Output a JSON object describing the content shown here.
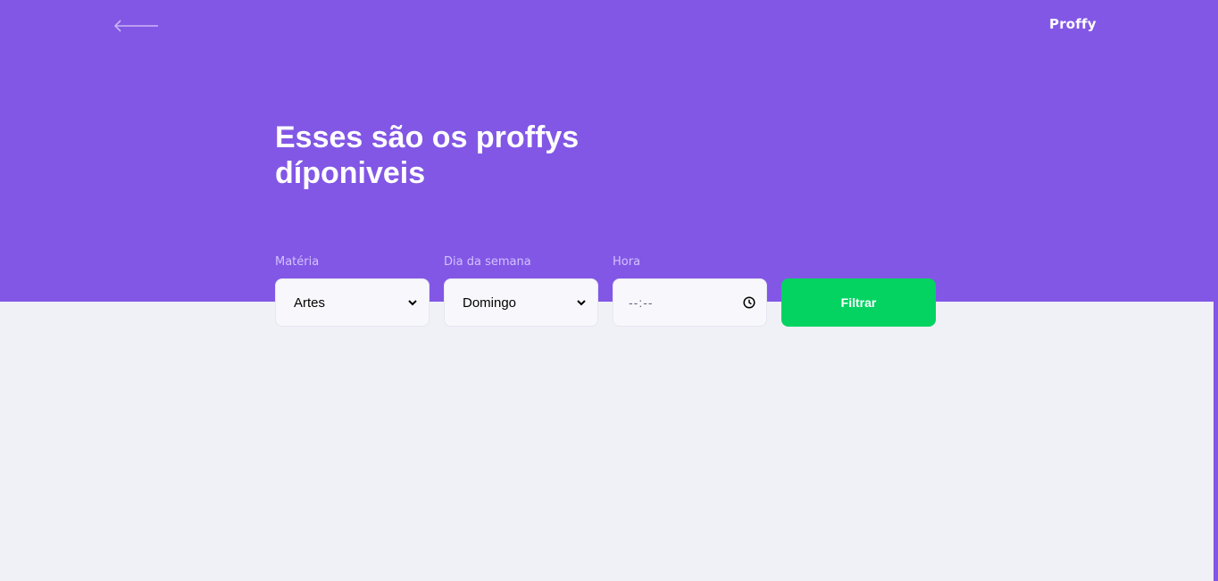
{
  "header": {
    "back_icon": "arrow-left-icon",
    "logo": "Proffy",
    "title_line1": "Esses são os proffys",
    "title_line2": "díponiveis"
  },
  "filters": {
    "subject": {
      "label": "Matéria",
      "value": "Artes",
      "icon": "chevron-down-icon"
    },
    "week_day": {
      "label": "Dia da semana",
      "value": "Domingo",
      "icon": "chevron-down-icon"
    },
    "time": {
      "label": "Hora",
      "value": "--:--",
      "icon": "clock-icon"
    },
    "submit_label": "Filtrar"
  },
  "colors": {
    "primary": "#8257E5",
    "background": "#F0F0F7",
    "secondary": "#04D361",
    "label": "#D4C2FF",
    "input_background": "#F8F8FC"
  }
}
